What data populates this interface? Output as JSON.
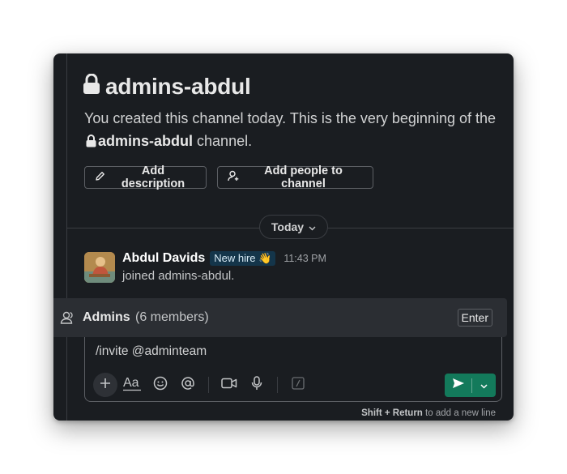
{
  "channel": {
    "name": "admins-abdul",
    "intro_prefix": "You created this channel today. This is the very beginning of the",
    "intro_suffix": "channel."
  },
  "actions": {
    "add_description": "Add description",
    "add_people": "Add people to channel"
  },
  "divider": {
    "label": "Today"
  },
  "message": {
    "author": "Abdul Davids",
    "badge": "New hire 👋",
    "time": "11:43 PM",
    "text": "joined admins-abdul."
  },
  "suggestion": {
    "name": "Admins",
    "members": "(6 members)",
    "key_hint": "Enter"
  },
  "composer": {
    "value": "/invite @adminteam"
  },
  "footer": {
    "hint_keys": "Shift + Return",
    "hint_text": "to add a new line"
  },
  "colors": {
    "background": "#1a1d21",
    "send_button": "#137a5b",
    "badge_bg": "#14354a"
  },
  "icons": [
    "lock-icon",
    "pencil-icon",
    "add-person-icon",
    "chevron-down-icon",
    "user-group-icon",
    "plus-icon",
    "text-format-icon",
    "emoji-icon",
    "mention-icon",
    "video-icon",
    "microphone-icon",
    "slash-command-icon",
    "send-icon"
  ]
}
